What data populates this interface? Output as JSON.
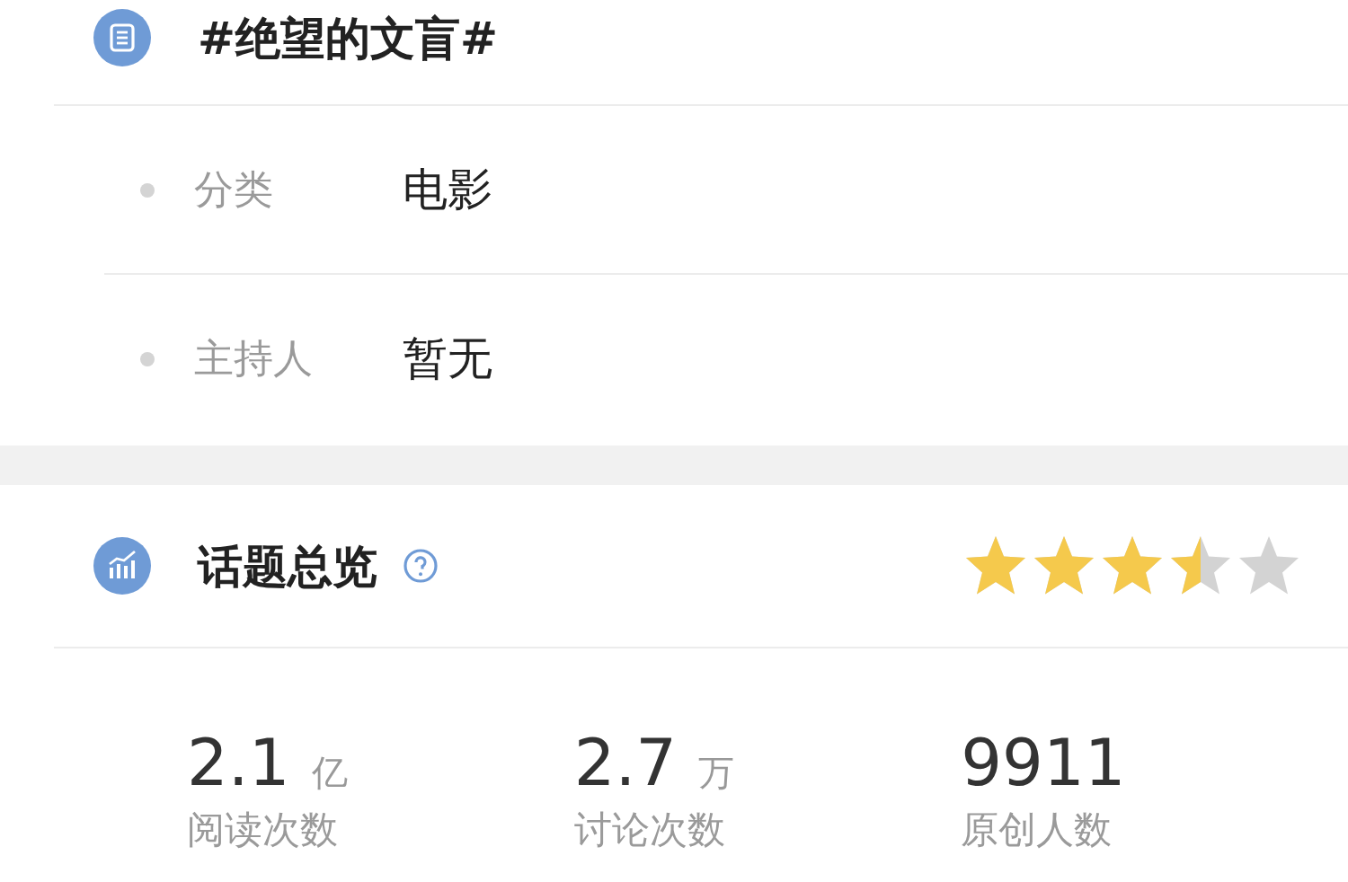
{
  "topic": {
    "title": "#绝望的文盲#"
  },
  "info_rows": [
    {
      "label": "分类",
      "value": "电影"
    },
    {
      "label": "主持人",
      "value": "暂无"
    }
  ],
  "overview": {
    "title": "话题总览",
    "stars": 3.5
  },
  "stats": [
    {
      "number": "2.1",
      "unit": "亿",
      "label": "阅读次数"
    },
    {
      "number": "2.7",
      "unit": "万",
      "label": "讨论次数"
    },
    {
      "number": "9911",
      "label": "原创人数"
    }
  ]
}
